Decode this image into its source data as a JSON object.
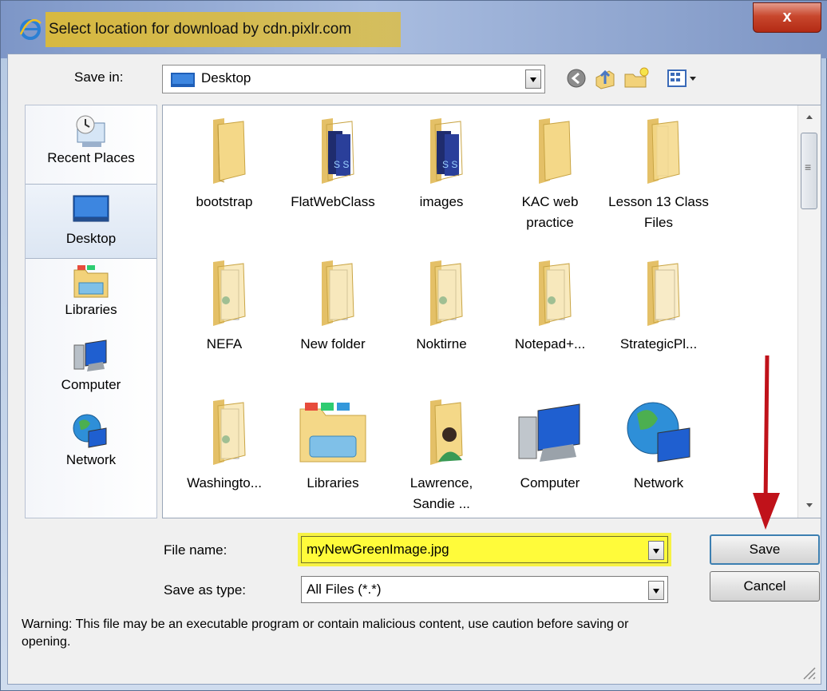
{
  "window": {
    "title": "Select location for download by cdn.pixlr.com",
    "close_label": "x"
  },
  "save_in": {
    "label": "Save in:",
    "value": "Desktop"
  },
  "toolbar": {
    "icons": [
      "back-icon",
      "up-folder-icon",
      "new-folder-icon",
      "view-menu-icon"
    ]
  },
  "places": [
    {
      "label": "Recent Places",
      "icon": "recent-places-icon"
    },
    {
      "label": "Desktop",
      "icon": "desktop-icon",
      "selected": true
    },
    {
      "label": "Libraries",
      "icon": "libraries-icon"
    },
    {
      "label": "Computer",
      "icon": "computer-icon"
    },
    {
      "label": "Network",
      "icon": "network-icon"
    }
  ],
  "items": [
    {
      "name": "bootstrap",
      "type": "folder"
    },
    {
      "name": "FlatWebClass",
      "type": "folder-docs"
    },
    {
      "name": "images",
      "type": "folder-docs"
    },
    {
      "name": "KAC web practice",
      "type": "folder"
    },
    {
      "name": "Lesson 13 Class Files",
      "type": "folder"
    },
    {
      "name": "NEFA",
      "type": "folder-paper"
    },
    {
      "name": "New folder",
      "type": "folder-paper"
    },
    {
      "name": "Noktirne",
      "type": "folder-paper"
    },
    {
      "name": "Notepad+...",
      "type": "folder-paper"
    },
    {
      "name": "StrategicPl...",
      "type": "folder-paper"
    },
    {
      "name": "Washingto...",
      "type": "folder-paper"
    },
    {
      "name": "Libraries",
      "type": "libraries"
    },
    {
      "name": "Lawrence, Sandie ...",
      "type": "user-folder"
    },
    {
      "name": "Computer",
      "type": "computer"
    },
    {
      "name": "Network",
      "type": "network"
    }
  ],
  "file_name": {
    "label": "File name:",
    "value": "myNewGreenImage.jpg"
  },
  "save_as_type": {
    "label": "Save as type:",
    "value": "All Files (*.*)"
  },
  "buttons": {
    "save": "Save",
    "cancel": "Cancel"
  },
  "warning": "Warning: This file may be an executable program or contain malicious content, use caution before saving or opening.",
  "colors": {
    "title_highlight": "#e6be28",
    "field_highlight": "#fffb3a",
    "annotation_arrow": "#c0121a",
    "folder": "#f2d27a"
  }
}
